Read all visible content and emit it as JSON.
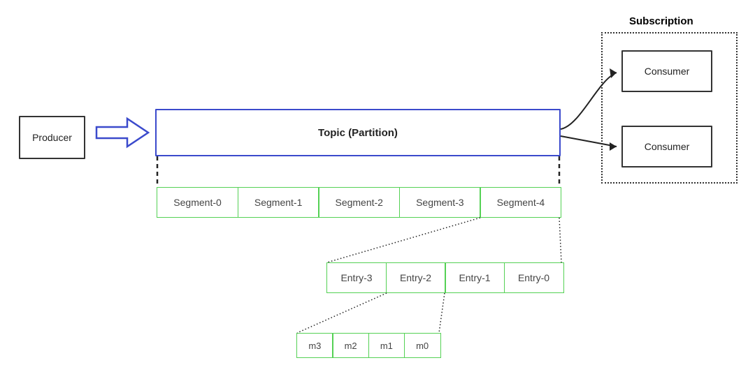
{
  "producer": {
    "label": "Producer"
  },
  "topic": {
    "label": "Topic (Partition)"
  },
  "subscription": {
    "title": "Subscription",
    "consumers": [
      {
        "label": "Consumer"
      },
      {
        "label": "Consumer"
      }
    ]
  },
  "segments": [
    {
      "label": "Segment-0"
    },
    {
      "label": "Segment-1"
    },
    {
      "label": "Segment-2"
    },
    {
      "label": "Segment-3"
    },
    {
      "label": "Segment-4"
    }
  ],
  "entries": [
    {
      "label": "Entry-3"
    },
    {
      "label": "Entry-2"
    },
    {
      "label": "Entry-1"
    },
    {
      "label": "Entry-0"
    }
  ],
  "messages": [
    {
      "label": "m3"
    },
    {
      "label": "m2"
    },
    {
      "label": "m1"
    },
    {
      "label": "m0"
    }
  ],
  "colors": {
    "blue": "#3b4acc",
    "green": "#54d154",
    "black": "#333"
  }
}
